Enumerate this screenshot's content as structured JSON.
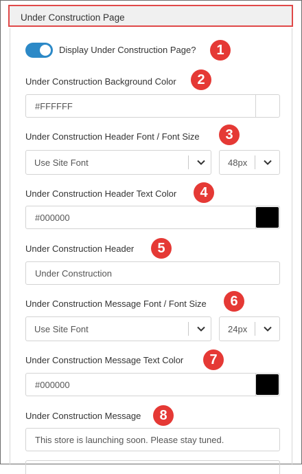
{
  "panel": {
    "title": "Under Construction Page"
  },
  "display_toggle": {
    "label": "Display Under Construction Page?",
    "checked": true
  },
  "background_color": {
    "label": "Under Construction Background Color",
    "value": "#FFFFFF",
    "swatch": "#ffffff"
  },
  "header_font": {
    "label": "Under Construction Header Font / Font Size",
    "font_value": "Use Site Font",
    "size_value": "48px"
  },
  "header_text_color": {
    "label": "Under Construction Header Text Color",
    "value": "#000000",
    "swatch": "#000000"
  },
  "header_text": {
    "label": "Under Construction Header",
    "value": "Under Construction"
  },
  "message_font": {
    "label": "Under Construction Message Font / Font Size",
    "font_value": "Use Site Font",
    "size_value": "24px"
  },
  "message_text_color": {
    "label": "Under Construction Message Text Color",
    "value": "#000000",
    "swatch": "#000000"
  },
  "message_text": {
    "label": "Under Construction Message",
    "value": "This store is launching soon. Please stay tuned."
  },
  "callouts": [
    "1",
    "2",
    "3",
    "4",
    "5",
    "6",
    "7",
    "8"
  ],
  "colors": {
    "toggle_on": "#2c89c7",
    "callout_badge": "#e53935",
    "header_highlight_border": "#e04848"
  },
  "icons": {
    "select_chevron": "chevron-down-icon"
  }
}
